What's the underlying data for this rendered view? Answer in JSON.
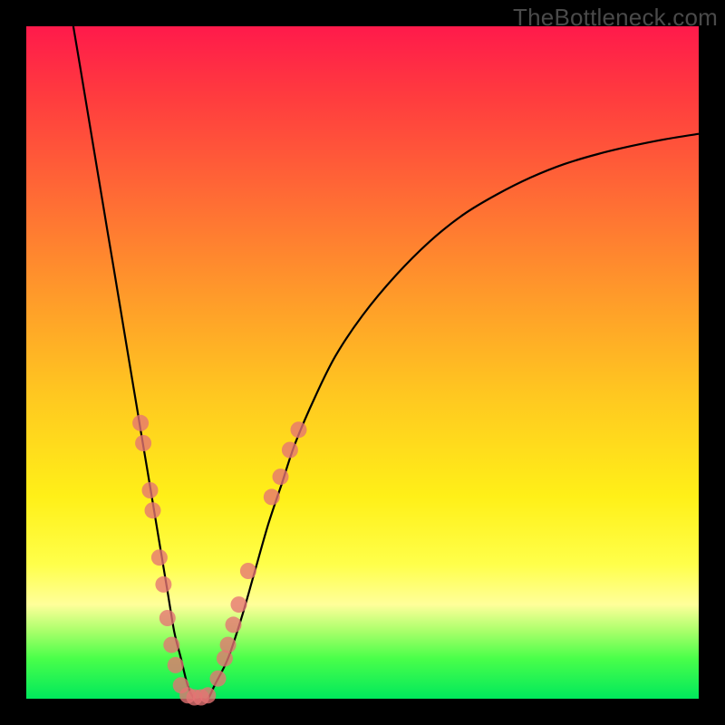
{
  "watermark": "TheBottleneck.com",
  "colors": {
    "background_frame": "#000000",
    "gradient_top": "#ff1a4b",
    "gradient_bottom": "#00e85c",
    "curve": "#000000",
    "marker": "#e57373"
  },
  "chart_data": {
    "type": "line",
    "title": "",
    "xlabel": "",
    "ylabel": "",
    "xlim": [
      0,
      100
    ],
    "ylim": [
      0,
      100
    ],
    "grid": false,
    "series": [
      {
        "name": "curve",
        "x": [
          7,
          8,
          9,
          10,
          11,
          12,
          13,
          14,
          15,
          16,
          17,
          18,
          19,
          20,
          21,
          22,
          23,
          24,
          25,
          26,
          27,
          28,
          30,
          32,
          34,
          36,
          38,
          40,
          43,
          46,
          50,
          55,
          60,
          65,
          70,
          75,
          80,
          85,
          90,
          95,
          100
        ],
        "y": [
          100,
          94,
          88,
          82,
          76,
          70,
          64,
          58,
          52,
          46,
          40,
          34,
          28,
          22,
          16,
          10,
          6,
          2,
          0,
          0,
          0,
          2,
          6,
          12,
          19,
          26,
          32,
          38,
          45,
          51,
          57,
          63,
          68,
          72,
          75,
          77.5,
          79.5,
          81,
          82.2,
          83.2,
          84
        ]
      }
    ],
    "markers": [
      {
        "x": 17.0,
        "y": 41
      },
      {
        "x": 17.4,
        "y": 38
      },
      {
        "x": 18.4,
        "y": 31
      },
      {
        "x": 18.8,
        "y": 28
      },
      {
        "x": 19.8,
        "y": 21
      },
      {
        "x": 20.4,
        "y": 17
      },
      {
        "x": 21.0,
        "y": 12
      },
      {
        "x": 21.6,
        "y": 8
      },
      {
        "x": 22.2,
        "y": 5
      },
      {
        "x": 23.0,
        "y": 2
      },
      {
        "x": 24.0,
        "y": 0.5
      },
      {
        "x": 25.0,
        "y": 0.2
      },
      {
        "x": 26.0,
        "y": 0.2
      },
      {
        "x": 27.0,
        "y": 0.5
      },
      {
        "x": 28.5,
        "y": 3
      },
      {
        "x": 29.5,
        "y": 6
      },
      {
        "x": 30.0,
        "y": 8
      },
      {
        "x": 30.8,
        "y": 11
      },
      {
        "x": 31.6,
        "y": 14
      },
      {
        "x": 33.0,
        "y": 19
      },
      {
        "x": 36.5,
        "y": 30
      },
      {
        "x": 37.8,
        "y": 33
      },
      {
        "x": 39.2,
        "y": 37
      },
      {
        "x": 40.5,
        "y": 40
      }
    ]
  }
}
